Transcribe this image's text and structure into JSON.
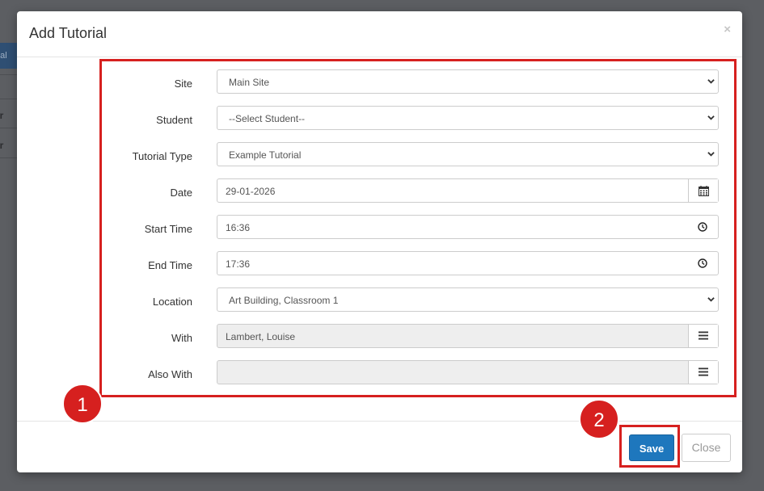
{
  "background": {
    "tab_fragment": "rial",
    "row_fragments": [
      "er",
      "er"
    ]
  },
  "modal": {
    "title": "Add Tutorial",
    "close_symbol": "×"
  },
  "form": {
    "site": {
      "label": "Site",
      "value": "Main Site"
    },
    "student": {
      "label": "Student",
      "value": "--Select Student--"
    },
    "tutorial_type": {
      "label": "Tutorial Type",
      "value": "Example Tutorial"
    },
    "date": {
      "label": "Date",
      "value": "29-01-2026",
      "icon": "calendar-icon"
    },
    "start_time": {
      "label": "Start Time",
      "value": "16:36",
      "icon": "clock-icon"
    },
    "end_time": {
      "label": "End Time",
      "value": "17:36",
      "icon": "clock-icon"
    },
    "location": {
      "label": "Location",
      "value": "Art Building, Classroom 1"
    },
    "with": {
      "label": "With",
      "value": "Lambert, Louise",
      "icon": "list-icon"
    },
    "also_with": {
      "label": "Also With",
      "value": "",
      "icon": "list-icon"
    }
  },
  "annotations": {
    "badge_1": "1",
    "badge_2": "2",
    "color": "#d6201f"
  },
  "footer": {
    "save_label": "Save",
    "close_label": "Close"
  },
  "colors": {
    "primary": "#1e77bd",
    "highlight": "#d6201f",
    "overlay": "#5c5e62"
  }
}
